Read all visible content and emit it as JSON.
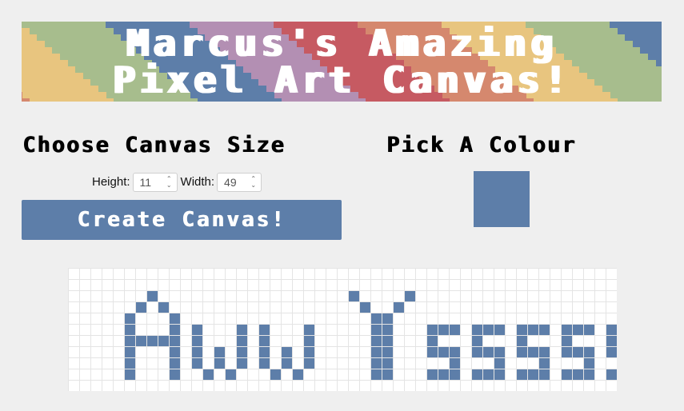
{
  "header": {
    "title_line1": "Marcus's Amazing",
    "title_line2": "Pixel Art Canvas!"
  },
  "size_section": {
    "heading": "Choose Canvas Size",
    "height_label": "Height:",
    "height_value": "11",
    "width_label": "Width:",
    "width_value": "49",
    "create_button_label": "Create Canvas!"
  },
  "colour_section": {
    "heading": "Pick A Colour",
    "selected_colour": "#5d7ea9"
  },
  "banner_colors": [
    "#c65a62",
    "#d5886e",
    "#e8c57f",
    "#a7bd8d",
    "#5d7ea9",
    "#b38fb3"
  ],
  "canvas": {
    "rows": 11,
    "cols": 49,
    "empty_color": "#ffffff",
    "paint_color": "#5d7ea9",
    "painted": [
      "0000000000000000000000000000000000000000000000000",
      "0000000000000000000000000000000000000000000000000",
      "0000000100000000000000000100001000000000000000000",
      "0000001010000000000000000010010000000000000000000",
      "0000010001000000000000000001100000000000000000000",
      "0000010001010001010001000001100011101110111011101",
      "0000011111010001010001000001100010001000100010001",
      "0000010001010101010101000001100011101110111011101",
      "0000010001010101010101000001100000100010001000100",
      "0000010001001010001010000001100011101110111011101",
      "0000000000000000000000000000000000000000000000000"
    ]
  }
}
